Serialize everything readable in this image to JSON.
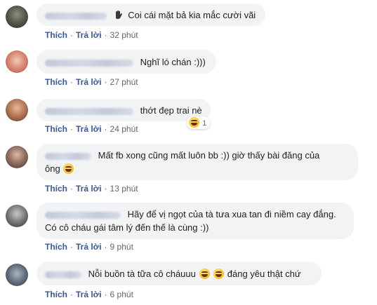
{
  "comments": [
    {
      "author": "",
      "text": "Coi cái mặt bả kia mắc cười vãi",
      "like": "Thích",
      "reply": "Trả lời",
      "time": "32 phút"
    },
    {
      "author": "",
      "text": "Nghĩ ló chán :)))",
      "like": "Thích",
      "reply": "Trả lời",
      "time": "27 phút"
    },
    {
      "author": "",
      "text": "thớt đẹp trai nè",
      "like": "Thích",
      "reply": "Trả lời",
      "time": "24 phút",
      "reaction_count": "1"
    },
    {
      "author": "",
      "text_line1": "Mất fb xong cũng mất luôn bb :)) giờ thấy bài đăng của",
      "text_line2": "ông",
      "like": "Thích",
      "reply": "Trả lời",
      "time": "13 phút"
    },
    {
      "author": "",
      "text_line1": "Hãy để vị ngọt của tà tưa xua tan đi niềm cay đắng.",
      "text_line2": "Có cô cháu gái tâm lý đến thế là cùng :))",
      "like": "Thích",
      "reply": "Trả lời",
      "time": "9 phút"
    },
    {
      "author": "",
      "text_a": "Nỗi buồn tà tữa cô cháuuu",
      "text_b": "đáng yêu thật chứ",
      "like": "Thích",
      "reply": "Trả lời",
      "time": "6 phút"
    }
  ],
  "separator": "·",
  "colors": {
    "bubble": "#f2f3f5",
    "link": "#385898",
    "meta": "#606770",
    "text": "#1c1e21"
  }
}
